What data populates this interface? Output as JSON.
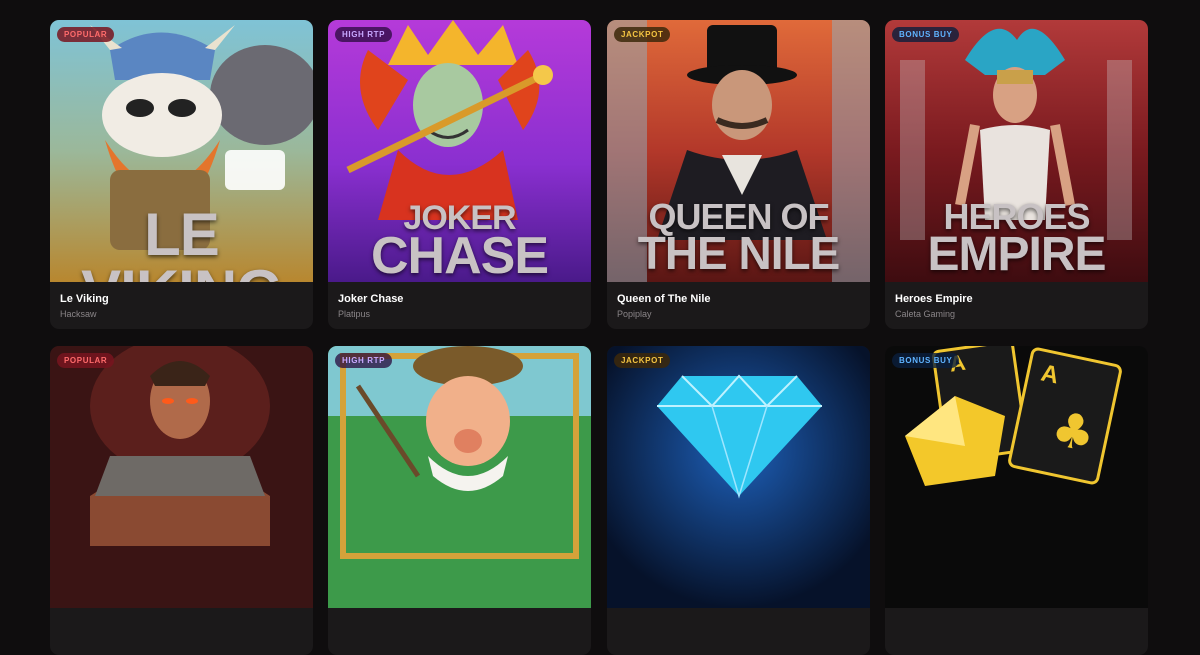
{
  "games": [
    {
      "title": "Le Viking",
      "provider": "Hacksaw",
      "badge": "POPULAR",
      "art_title_line1": "LE VIKING",
      "art_title_line2": ""
    },
    {
      "title": "Joker Chase",
      "provider": "Platipus",
      "badge": "HIGH RTP",
      "art_title_line1": "JOKER",
      "art_title_line2": "CHASE"
    },
    {
      "title": "Queen of The Nile",
      "provider": "Popiplay",
      "badge": "JACKPOT",
      "art_title_line1": "QUEEN OF",
      "art_title_line2": "THE NILE"
    },
    {
      "title": "Heroes Empire",
      "provider": "Caleta Gaming",
      "badge": "BONUS BUY",
      "art_title_line1": "HEROES",
      "art_title_line2": "EMPIRE"
    },
    {
      "badge": "POPULAR"
    },
    {
      "badge": "HIGH RTP"
    },
    {
      "badge": "JACKPOT"
    },
    {
      "badge": "BONUS BUY"
    }
  ],
  "colors": {
    "background": "#0f0d0e",
    "card": "#1b191a",
    "popular": "#ff6b6b",
    "high_rtp": "#c8a8ff",
    "jackpot": "#f5c542",
    "bonus_buy": "#5fb3ff"
  }
}
